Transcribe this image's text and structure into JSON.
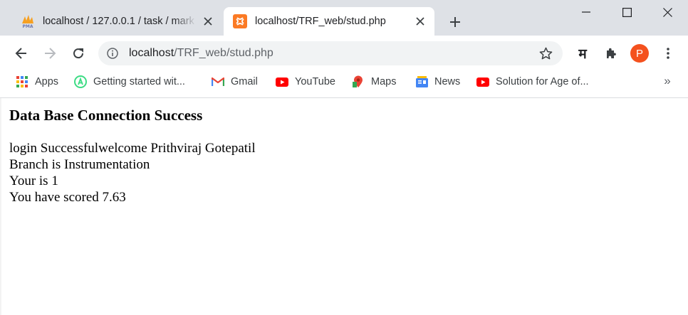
{
  "tabs": [
    {
      "title": "localhost / 127.0.0.1 / task / mark",
      "favicon": "phpmyadmin-icon",
      "active": false
    },
    {
      "title": "localhost/TRF_web/stud.php",
      "favicon": "xampp-icon",
      "active": true
    }
  ],
  "address_bar": {
    "host": "localhost",
    "path": "/TRF_web/stud.php"
  },
  "toolbar": {
    "extension_glyph": "म",
    "profile_initial": "P"
  },
  "bookmarks": [
    {
      "label": "Apps",
      "icon": "apps-grid-icon"
    },
    {
      "label": "Getting started wit...",
      "icon": "android-studio-icon"
    },
    {
      "label": "Gmail",
      "icon": "gmail-icon"
    },
    {
      "label": "YouTube",
      "icon": "youtube-icon"
    },
    {
      "label": "Maps",
      "icon": "maps-icon"
    },
    {
      "label": "News",
      "icon": "news-icon"
    },
    {
      "label": "Solution for Age of...",
      "icon": "youtube-icon"
    }
  ],
  "bookmarks_overflow": "»",
  "page": {
    "heading": "Data Base Connection Success",
    "lines": [
      "login Successfulwelcome Prithviraj Gotepatil",
      "Branch is Instrumentation",
      "Your is 1",
      "You have scored 7.63"
    ]
  },
  "colors": {
    "tabstrip": "#dee1e6",
    "omnibox": "#f1f3f4",
    "avatar": "#f4511e",
    "youtube": "#ff0000",
    "xampp": "#fb7a24"
  }
}
